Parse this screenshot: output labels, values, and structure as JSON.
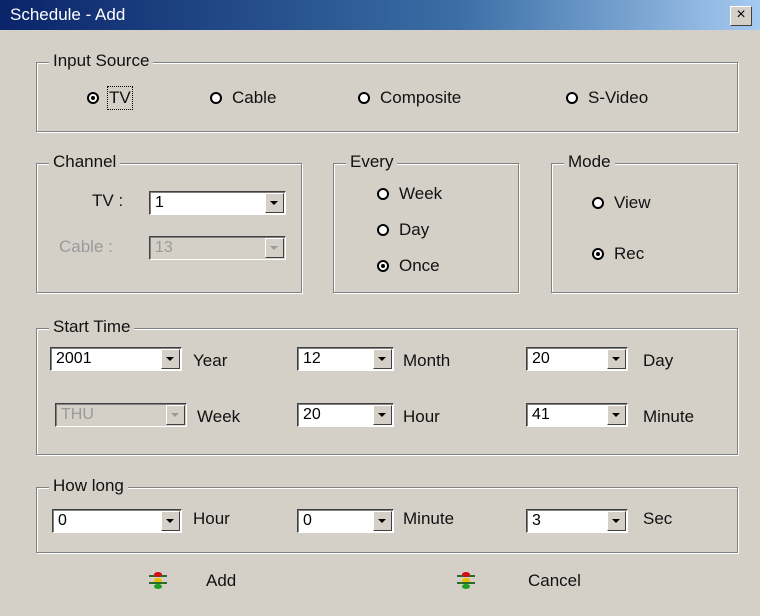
{
  "window": {
    "title": "Schedule - Add",
    "close_label": "×"
  },
  "input_source": {
    "legend": "Input Source",
    "options": [
      "TV",
      "Cable",
      "Composite",
      "S-Video"
    ],
    "selected": "TV"
  },
  "channel": {
    "legend": "Channel",
    "tv_label": "TV :",
    "tv_value": "1",
    "cable_label": "Cable :",
    "cable_value": "13"
  },
  "every": {
    "legend": "Every",
    "options": [
      "Week",
      "Day",
      "Once"
    ],
    "selected": "Once"
  },
  "mode": {
    "legend": "Mode",
    "options": [
      "View",
      "Rec"
    ],
    "selected": "Rec"
  },
  "start_time": {
    "legend": "Start Time",
    "year_value": "2001",
    "year_label": "Year",
    "month_value": "12",
    "month_label": "Month",
    "day_value": "20",
    "day_label": "Day",
    "week_value": "THU",
    "week_label": "Week",
    "hour_value": "20",
    "hour_label": "Hour",
    "minute_value": "41",
    "minute_label": "Minute"
  },
  "how_long": {
    "legend": "How long",
    "hour_value": "0",
    "hour_label": "Hour",
    "minute_value": "0",
    "minute_label": "Minute",
    "sec_value": "3",
    "sec_label": "Sec"
  },
  "actions": {
    "add_label": "Add",
    "cancel_label": "Cancel"
  }
}
